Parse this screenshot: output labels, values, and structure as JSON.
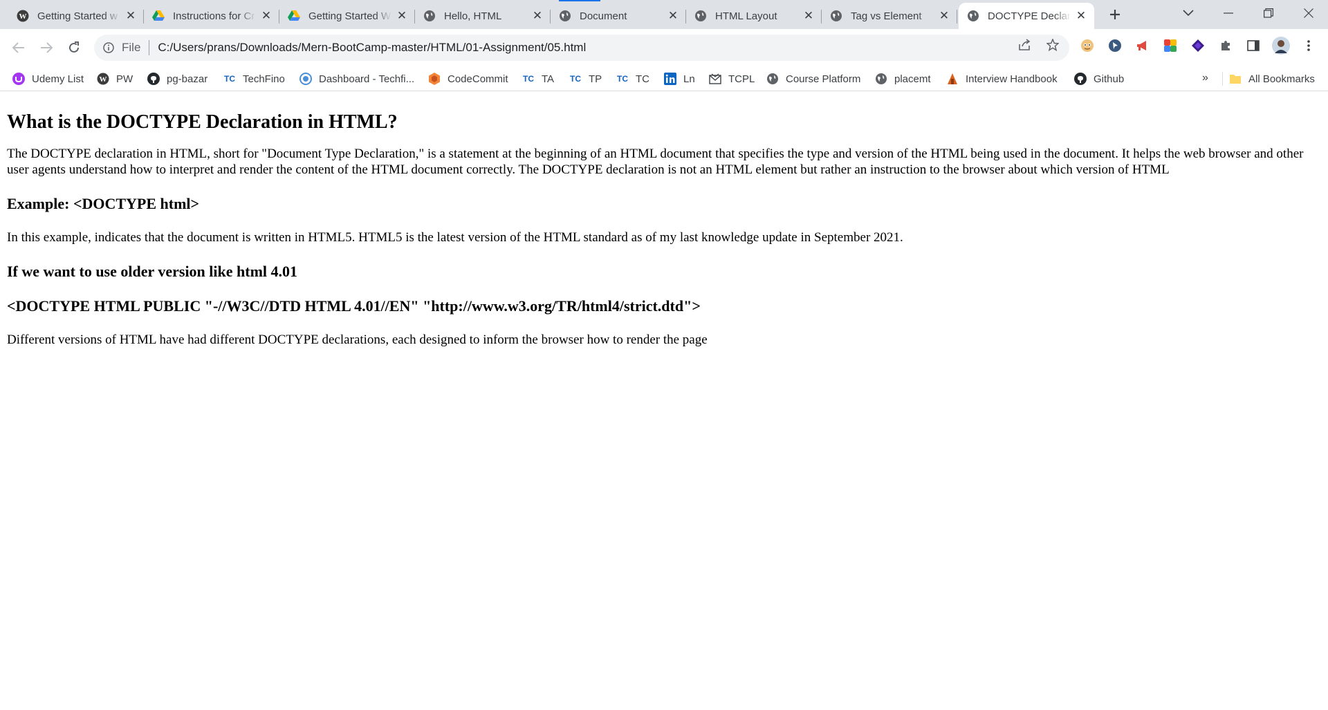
{
  "tabs": [
    {
      "title": "Getting Started w",
      "icon": "wordpress-icon"
    },
    {
      "title": "Instructions for Cr",
      "icon": "google-drive-icon"
    },
    {
      "title": "Getting Started W",
      "icon": "google-drive-icon"
    },
    {
      "title": "Hello, HTML",
      "icon": "globe-icon"
    },
    {
      "title": "Document",
      "icon": "globe-icon"
    },
    {
      "title": "HTML Layout",
      "icon": "globe-icon"
    },
    {
      "title": "Tag vs Element",
      "icon": "globe-icon"
    },
    {
      "title": "DOCTYPE Declara",
      "icon": "globe-icon",
      "active": true
    }
  ],
  "toolbar": {
    "scheme": "File",
    "url": "C:/Users/prans/Downloads/Mern-BootCamp-master/HTML/01-Assignment/05.html"
  },
  "bookmarks": [
    {
      "label": "Udemy List",
      "icon": "udemy-icon"
    },
    {
      "label": "PW",
      "icon": "wordpress-icon"
    },
    {
      "label": "pg-bazar",
      "icon": "github-icon"
    },
    {
      "label": "TechFino",
      "icon": "tc-icon"
    },
    {
      "label": "Dashboard - Techfi...",
      "icon": "dashboard-icon"
    },
    {
      "label": "CodeCommit",
      "icon": "codecommit-icon"
    },
    {
      "label": "TA",
      "icon": "tc-icon"
    },
    {
      "label": "TP",
      "icon": "tc-icon"
    },
    {
      "label": "TC",
      "icon": "tc-icon"
    },
    {
      "label": "Ln",
      "icon": "linkedin-icon"
    },
    {
      "label": "TCPL",
      "icon": "mail-icon"
    },
    {
      "label": "Course Platform",
      "icon": "globe-icon"
    },
    {
      "label": "placemt",
      "icon": "globe-icon"
    },
    {
      "label": "Interview Handbook",
      "icon": "handbook-icon"
    },
    {
      "label": "Github",
      "icon": "github-icon"
    }
  ],
  "bookmarks_overflow": "»",
  "all_bookmarks": "All Bookmarks",
  "content": {
    "heading": "What is the DOCTYPE Declaration in HTML?",
    "intro": "The DOCTYPE declaration in HTML, short for \"Document Type Declaration,\" is a statement at the beginning of an HTML document that specifies the type and version of the HTML being used in the document. It helps the web browser and other user agents understand how to interpret and render the content of the HTML document correctly. The DOCTYPE declaration is not an HTML element but rather an instruction to the browser about which version of HTML",
    "example_heading": "Example: <DOCTYPE html>",
    "example_text": "In this example, indicates that the document is written in HTML5. HTML5 is the latest version of the HTML standard as of my last knowledge update in September 2021.",
    "older_heading": "If we want to use older version like html 4.01",
    "doctype_heading": "<DOCTYPE HTML PUBLIC \"-//W3C//DTD HTML 4.01//EN\" \"http://www.w3.org/TR/html4/strict.dtd\">",
    "closing_text": "Different versions of HTML have had different DOCTYPE declarations, each designed to inform the browser how to render the page"
  },
  "colors": {
    "tabstrip_bg": "#dee1e6",
    "omnibox_bg": "#f1f3f4",
    "accent": "#1a73e8"
  }
}
